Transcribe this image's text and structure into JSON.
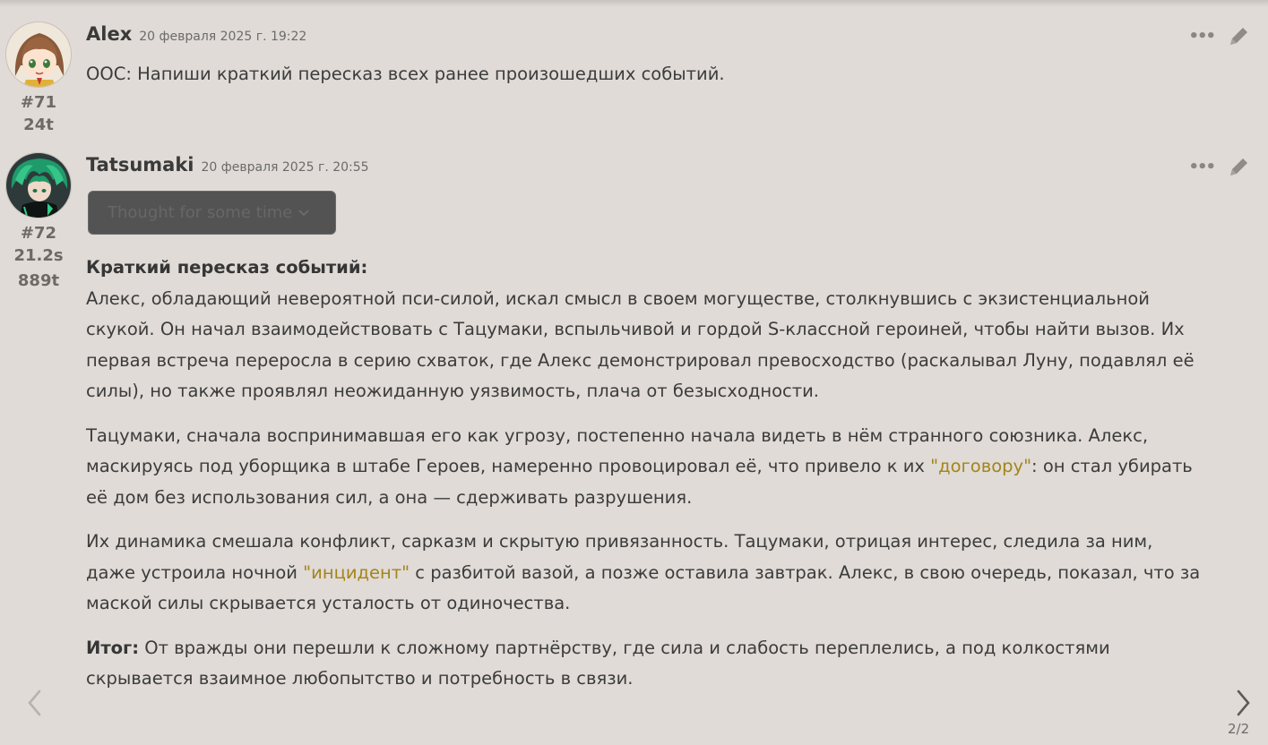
{
  "messages": [
    {
      "author": "Alex",
      "time": "20 февраля 2025 г. 19:22",
      "mes_id": "#71",
      "stats": [
        "24t"
      ],
      "text": "OOC: Напиши краткий пересказ всех ранее произошедших событий.",
      "avatar_icon": "chibi-brown-hair-avatar"
    },
    {
      "author": "Tatsumaki",
      "time": "20 февраля 2025 г. 20:55",
      "mes_id": "#72",
      "stats": [
        "21.2s",
        "889t"
      ],
      "thought_label": "Thought for some time",
      "avatar_icon": "green-hair-character-avatar",
      "heading": "Краткий пересказ событий:",
      "p1": "Алекс, обладающий невероятной пси-силой, искал смысл в своем могуществе, столкнувшись с экзистенциальной скукой. Он начал взаимодействовать с Тацумаки, вспыльчивой и гордой S-классной героиней, чтобы найти вызов. Их первая встреча переросла в серию схваток, где Алекс демонстрировал превосходство (раскалывал Луну, подавлял её силы), но также проявлял неожиданную уязвимость, плача от безысходности.",
      "p2_a": "Тацумаки, сначала воспринимавшая его как угрозу, постепенно начала видеть в нём странного союзника. Алекс, маскируясь под уборщика в штабе Героев, намеренно провоцировал её, что привело к их ",
      "p2_quote": "\"договору\"",
      "p2_b": ": он стал убирать её дом без использования сил, а она — сдерживать разрушения.",
      "p3_a": "Их динамика смешала конфликт, сарказм и скрытую привязанность. Тацумаки, отрицая интерес, следила за ним, даже устроила ночной ",
      "p3_quote": "\"инцидент\"",
      "p3_b": " с разбитой вазой, а позже оставила завтрак. Алекс, в свою очередь, показал, что за маской силы скрывается усталость от одиночества.",
      "p4_label": "Итог:",
      "p4_text": " От вражды они перешли к сложному партнёрству, где сила и слабость переплелись, а под колкостями скрывается взаимное любопытство и потребность в связи."
    }
  ],
  "swipe_counter": "2/2",
  "colors": {
    "background": "#e0dbd6",
    "quote": "#a4841c",
    "thought_box": "#535353"
  }
}
